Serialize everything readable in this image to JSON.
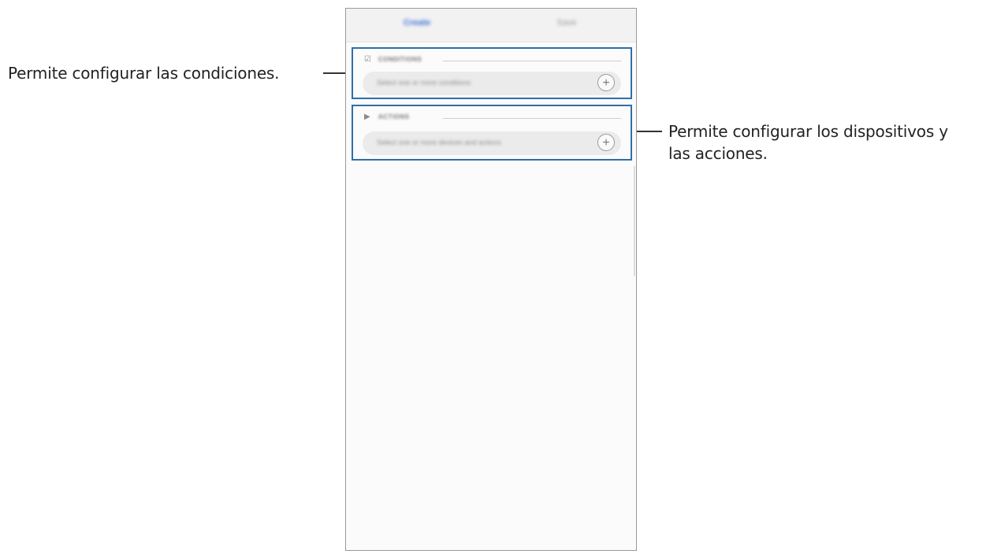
{
  "callouts": {
    "conditions": "Permite configurar las condiciones.",
    "actions_line1": "Permite configurar los dispositivos y",
    "actions_line2": "las acciones."
  },
  "tabs": [
    {
      "label": "Create"
    },
    {
      "label": "Save"
    }
  ],
  "sections": {
    "conditions": {
      "icon": "checkbox-icon",
      "title": "CONDITIONS",
      "placeholder": "Select one or more conditions"
    },
    "actions": {
      "icon": "play-icon",
      "title": "ACTIONS",
      "placeholder": "Select one or more devices and actions"
    }
  },
  "colors": {
    "highlight_border": "#2f6fa6",
    "active_tab": "#3d6fd6"
  }
}
